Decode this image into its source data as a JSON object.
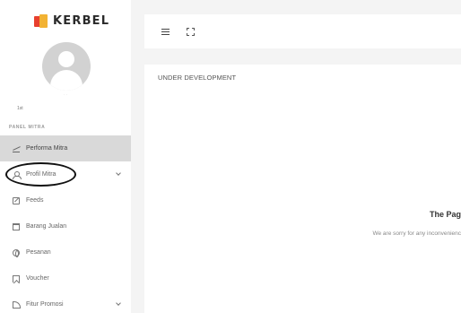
{
  "brand": {
    "name": "KERBEL"
  },
  "user": {
    "name": "·  ·",
    "role": "1st"
  },
  "sidebar": {
    "section_label": "PANEL MITRA",
    "items": [
      {
        "label": "Performa Mitra",
        "icon": "trending-up-icon",
        "active": true
      },
      {
        "label": "Profil Mitra",
        "icon": "user-icon",
        "has_submenu": true
      },
      {
        "label": "Feeds",
        "icon": "edit-icon"
      },
      {
        "label": "Barang Jualan",
        "icon": "archive-icon"
      },
      {
        "label": "Pesanan",
        "icon": "globe-icon"
      },
      {
        "label": "Voucher",
        "icon": "bookmark-icon"
      },
      {
        "label": "Fitur Promosi",
        "icon": "rss-icon",
        "has_submenu": true
      }
    ]
  },
  "topbar": {
    "menu_icon": "hamburger-icon",
    "fullscreen_icon": "fullscreen-icon"
  },
  "main": {
    "card_title": "UNDER DEVELOPMENT",
    "error_title": "The Pag",
    "error_message": "We are sorry for any inconvenienc"
  },
  "colors": {
    "accent_red": "#e8402e",
    "accent_yellow": "#f2b233",
    "active_bg": "#d9d9d9",
    "page_bg": "#f4f4f4"
  }
}
